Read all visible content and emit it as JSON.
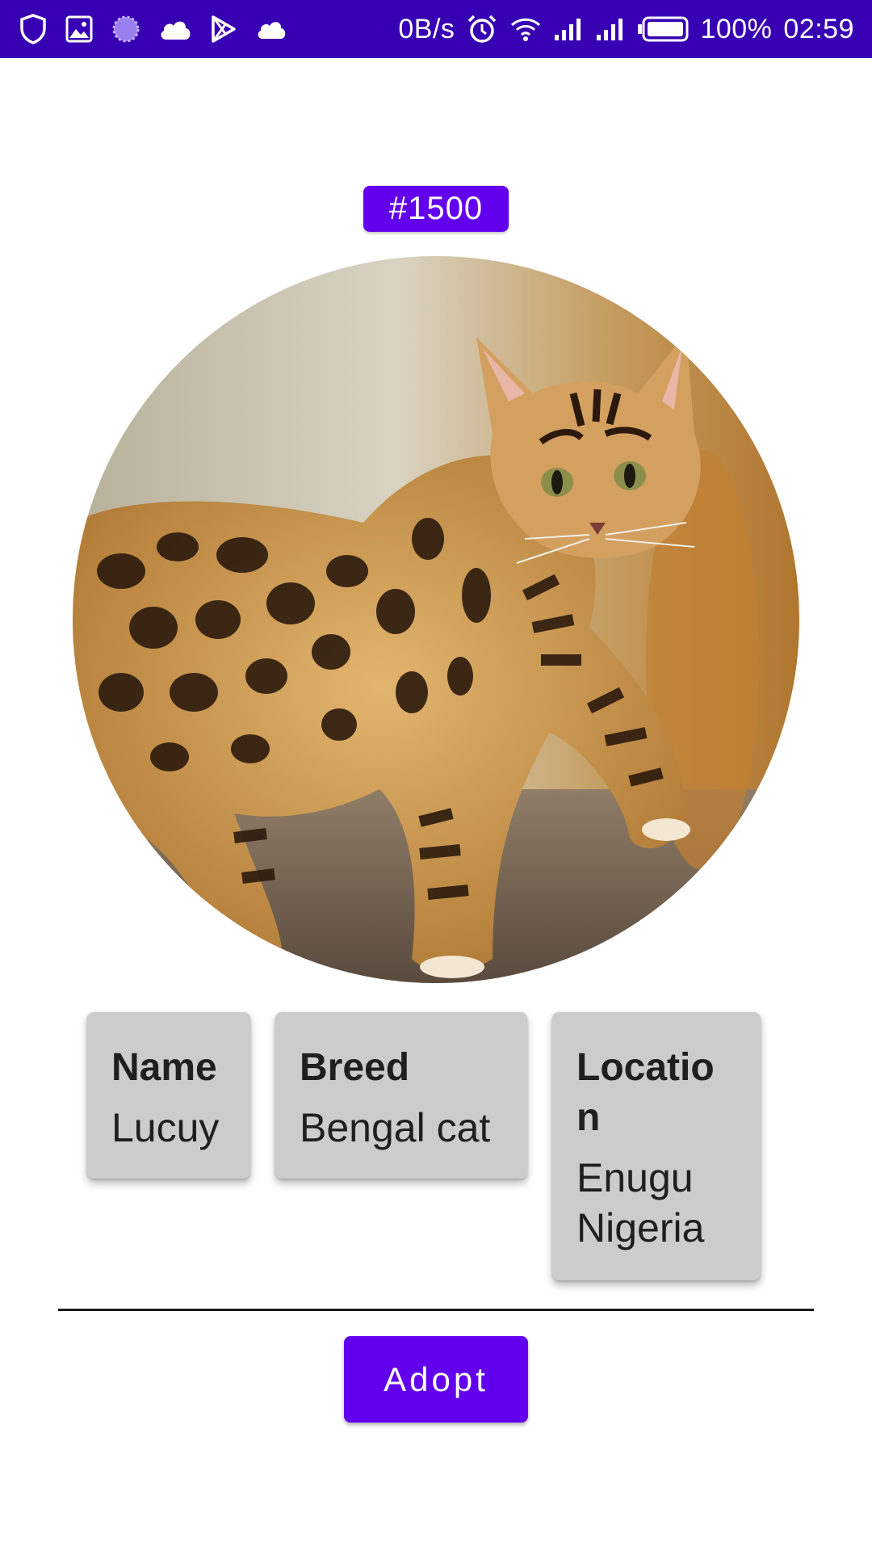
{
  "status_bar": {
    "network_speed": "0B/s",
    "battery_percent": "100%",
    "time": "02:59",
    "icons_left": [
      "shield-icon",
      "image-icon",
      "sync-progress-icon",
      "cloud-icon",
      "play-store-icon",
      "cloud-icon"
    ],
    "icons_right": [
      "alarm-icon",
      "wifi-icon",
      "signal-icon",
      "signal-icon",
      "battery-icon"
    ],
    "background_color": "#3700B3"
  },
  "pet": {
    "id_badge": "#1500",
    "photo": "bengal-cat-photo",
    "details": [
      {
        "title": "Name",
        "value": "Lucuy"
      },
      {
        "title": "Breed",
        "value": "Bengal cat"
      },
      {
        "title": "Location",
        "value": "Enugu Nigeria"
      }
    ]
  },
  "actions": {
    "adopt_label": "Adopt"
  },
  "colors": {
    "accent": "#6200EE",
    "card_background": "#CCCCCC"
  }
}
